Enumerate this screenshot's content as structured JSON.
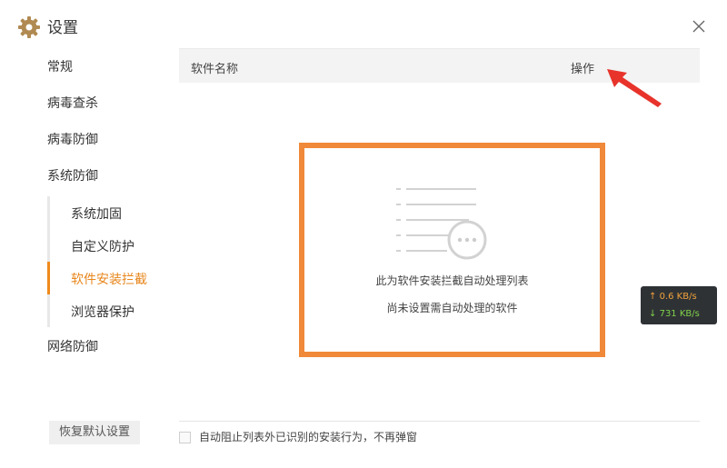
{
  "window": {
    "title": "设置",
    "icons": {
      "title": "gear-icon",
      "close": "close-icon"
    }
  },
  "sidebar": {
    "items": [
      {
        "label": "常规"
      },
      {
        "label": "病毒查杀"
      },
      {
        "label": "病毒防御"
      },
      {
        "label": "系统防御"
      },
      {
        "label": "网络防御"
      }
    ],
    "sub_items": [
      {
        "label": "系统加固"
      },
      {
        "label": "自定义防护"
      },
      {
        "label": "软件安装拦截",
        "active": true
      },
      {
        "label": "浏览器保护"
      }
    ],
    "restore_button": "恢复默认设置"
  },
  "table": {
    "columns": [
      "软件名称",
      "操作"
    ]
  },
  "empty_state": {
    "line1": "此为软件安装拦截自动处理列表",
    "line2": "尚未设置需自动处理的软件"
  },
  "footer": {
    "checkbox_label": "自动阻止列表外已识别的安装行为，不再弹窗",
    "checked": false
  },
  "net_speed": {
    "upload": "0.6 KB/s",
    "download": "731 KB/s"
  },
  "colors": {
    "accent": "#f08a1c",
    "highlight_box": "#f0893a",
    "annotation_arrow": "#e8332b",
    "upload": "#f0a23c",
    "download": "#7fd14a"
  }
}
